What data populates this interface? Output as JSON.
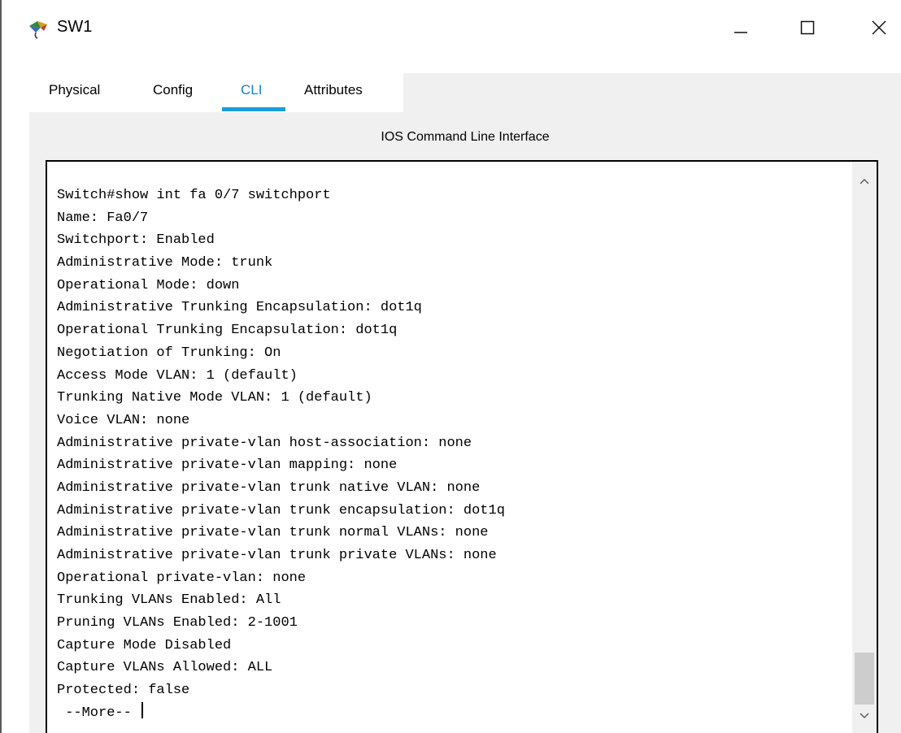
{
  "window": {
    "title": "SW1",
    "icon": "packet-tracer-switch-icon"
  },
  "window_controls": {
    "minimize": "minimize-icon",
    "maximize": "maximize-icon",
    "close": "close-icon"
  },
  "tabs": [
    {
      "label": "Physical",
      "active": false
    },
    {
      "label": "Config",
      "active": false
    },
    {
      "label": "CLI",
      "active": true
    },
    {
      "label": "Attributes",
      "active": false
    }
  ],
  "cli": {
    "header": "IOS Command Line Interface",
    "lines": [
      "Switch#show int fa 0/7 switchport",
      "Name: Fa0/7",
      "Switchport: Enabled",
      "Administrative Mode: trunk",
      "Operational Mode: down",
      "Administrative Trunking Encapsulation: dot1q",
      "Operational Trunking Encapsulation: dot1q",
      "Negotiation of Trunking: On",
      "Access Mode VLAN: 1 (default)",
      "Trunking Native Mode VLAN: 1 (default)",
      "Voice VLAN: none",
      "Administrative private-vlan host-association: none",
      "Administrative private-vlan mapping: none",
      "Administrative private-vlan trunk native VLAN: none",
      "Administrative private-vlan trunk encapsulation: dot1q",
      "Administrative private-vlan trunk normal VLANs: none",
      "Administrative private-vlan trunk private VLANs: none",
      "Operational private-vlan: none",
      "Trunking VLANs Enabled: All",
      "Pruning VLANs Enabled: 2-1001",
      "Capture Mode Disabled",
      "Capture VLANs Allowed: ALL",
      "Protected: false",
      " --More-- "
    ]
  },
  "colors": {
    "accent": "#1a9ed8",
    "active_tab_text": "#1a7ec9",
    "panel_bg": "#f0f0f0"
  }
}
